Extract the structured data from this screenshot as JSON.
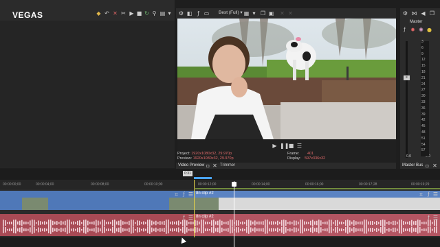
{
  "app": {
    "logo": "VEGAS"
  },
  "preview": {
    "quality": "Best (Full)",
    "project_label": "Project:",
    "project_value": "1920x1080x32, 29.970p",
    "preview_label": "Preview:",
    "preview_value": "1920x1080x32, 29.970p",
    "frame_label": "Frame:",
    "frame_value": "401",
    "display_label": "Display:",
    "display_value": "597x336x32",
    "tab_video_preview": "Video Preview",
    "tab_trimmer": "Trimmer"
  },
  "master": {
    "title": "Master",
    "tab": "Master Bus",
    "scale": [
      "3",
      "6",
      "9",
      "12",
      "15",
      "18",
      "21",
      "24",
      "27",
      "30",
      "33",
      "36",
      "39",
      "42",
      "45",
      "48",
      "51",
      "54",
      "57"
    ],
    "zero_left": "0.0",
    "zero_right": "0.0"
  },
  "timeline": {
    "cursor_time": "0:31",
    "ruler_labels": [
      "00:00:00;00",
      "00:00:04;00",
      "00:00:08;00",
      "00:00:10;00",
      "00:00:12;00",
      "00:00:14;00",
      "00:00:16;00",
      "00:00:17;28",
      "00:00:19;29"
    ],
    "video_clip_label": "8n clip #2",
    "audio_clip_label": "8n clip #2"
  },
  "colors": {
    "video_track": "#4f78b8",
    "audio_track": "#a84a55",
    "ruler_bar": "#6f8a3c"
  }
}
